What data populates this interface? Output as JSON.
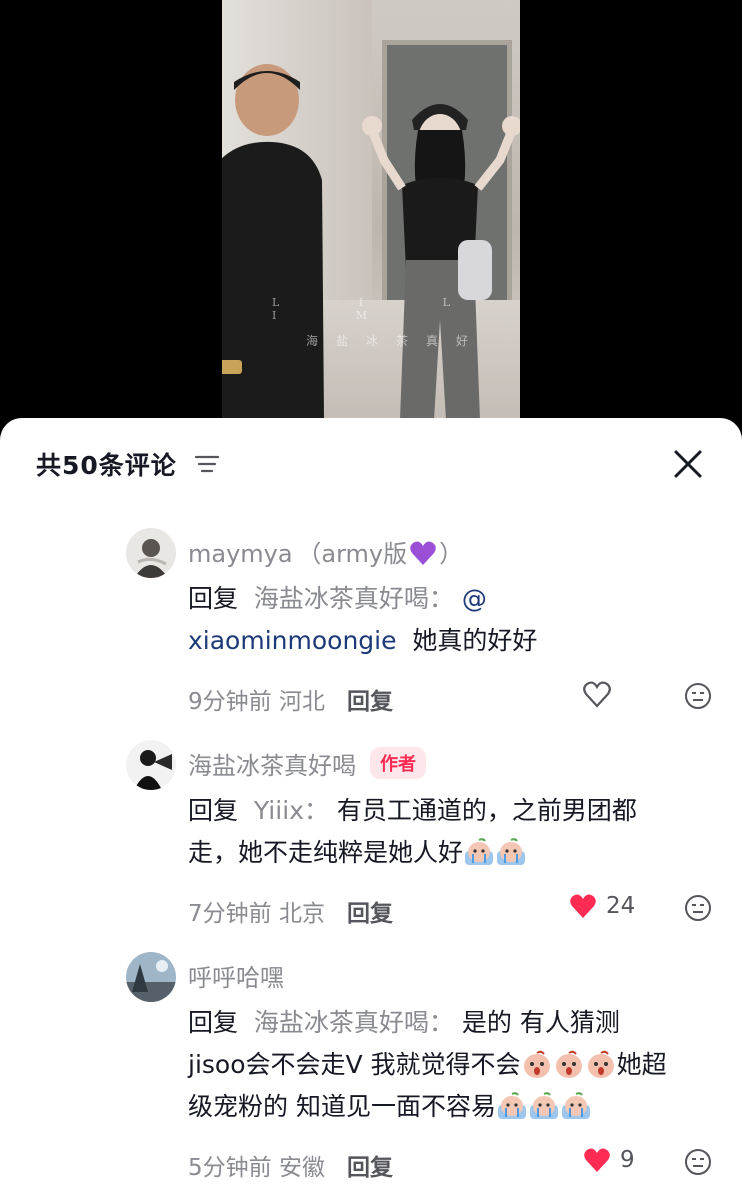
{
  "video": {
    "watermark_top": "L I L I M",
    "watermark_bottom": "海盐冰茶真好"
  },
  "header": {
    "count_label": "共50条评论",
    "sort_icon": "filter-lines-icon",
    "close_icon": "close-icon"
  },
  "comments": [
    {
      "username_main": "maymya （army版",
      "username_tail": "）",
      "emoji": "purple-heart",
      "reply_word": "回复",
      "reply_to": "海盐冰茶真好喝：",
      "mention_line1": "@",
      "mention_line2": "xiaominmoongie",
      "text": "她真的好好",
      "time": "9分钟前",
      "location": "河北",
      "reply_label": "回复",
      "liked": false,
      "like_count": ""
    },
    {
      "username": "海盐冰茶真好喝",
      "author_badge": "作者",
      "reply_word": "回复",
      "reply_to": "Yiiix：",
      "text1": "有员工通道的，之前男团都",
      "text2": "走，她不走纯粹是她人好",
      "time": "7分钟前",
      "location": "北京",
      "reply_label": "回复",
      "liked": true,
      "like_count": "24"
    },
    {
      "username": "呼呼哈嘿",
      "reply_word": "回复",
      "reply_to": "海盐冰茶真好喝：",
      "text1": "是的 有人猜测",
      "text2a": "jisoo会不会走V 我就觉得不会",
      "text2b": "她超",
      "text3": "级宠粉的 知道见一面不容易",
      "time": "5分钟前",
      "location": "安徽",
      "reply_label": "回复",
      "liked": true,
      "like_count": "9"
    }
  ],
  "colors": {
    "like_red": "#fe2c55",
    "muted_text": "#8a8b91",
    "mention_blue": "#1d3a78"
  }
}
